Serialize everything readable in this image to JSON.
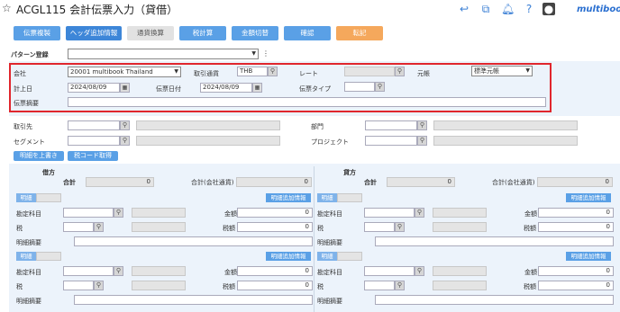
{
  "header": {
    "title": "ACGL115 会計伝票入力（貸借）",
    "logo": "multiboo",
    "icons": [
      "star-icon",
      "back-icon",
      "export-icon",
      "bell-icon",
      "help-icon",
      "user-avatar"
    ]
  },
  "toolbar": {
    "buttons": [
      "伝票複製",
      "ヘッダ追加情報",
      "通貨換算",
      "税計算",
      "金額切替",
      "確認",
      "転記"
    ]
  },
  "pattern": {
    "label": "パターン登録",
    "value": ""
  },
  "header_form": {
    "company_label": "会社",
    "company_value": "20001 multibook Thailand",
    "currency_label": "取引通貨",
    "currency_value": "THB",
    "rate_label": "レート",
    "ledger_label": "元帳",
    "ledger_value": "標準元帳",
    "posting_date_label": "計上日",
    "posting_date_value": "2024/08/09",
    "voucher_date_label": "伝票日付",
    "voucher_date_value": "2024/08/09",
    "voucher_type_label": "伝票タイプ",
    "summary_label": "伝票摘要"
  },
  "sub_form": {
    "partner_label": "取引先",
    "segment_label": "セグメント",
    "dept_label": "部門",
    "project_label": "プロジェクト",
    "overwrite_btn": "明細を上書き",
    "tax_code_btn": "税コード取得"
  },
  "debit": {
    "title": "借方",
    "total_label": "合計",
    "total_value": "0",
    "company_total_label": "合計(会社通貨)",
    "company_total_value": "0",
    "lines": [
      {
        "tag": "明細",
        "extra_btn": "明細追加情報",
        "account_label": "勘定科目",
        "amount_label": "金額",
        "amount_value": "0",
        "tax_label": "税",
        "tax_amount_label": "税額",
        "tax_amount_value": "0",
        "memo_label": "明細摘要"
      },
      {
        "tag": "明細",
        "extra_btn": "明細追加情報",
        "account_label": "勘定科目",
        "amount_label": "金額",
        "amount_value": "0",
        "tax_label": "税",
        "tax_amount_label": "税額",
        "tax_amount_value": "0",
        "memo_label": "明細摘要"
      }
    ]
  },
  "credit": {
    "title": "貸方",
    "total_label": "合計",
    "total_value": "0",
    "company_total_label": "合計(会社通貨)",
    "company_total_value": "0",
    "lines": [
      {
        "tag": "明細",
        "extra_btn": "明細追加情報",
        "account_label": "勘定科目",
        "amount_label": "金額",
        "amount_value": "0",
        "tax_label": "税",
        "tax_amount_label": "税額",
        "tax_amount_value": "0",
        "memo_label": "明細摘要"
      },
      {
        "tag": "明細",
        "extra_btn": "明細追加情報",
        "account_label": "勘定科目",
        "amount_label": "金額",
        "amount_value": "0",
        "tax_label": "税",
        "tax_amount_label": "税額",
        "tax_amount_value": "0",
        "memo_label": "明細摘要"
      }
    ]
  }
}
